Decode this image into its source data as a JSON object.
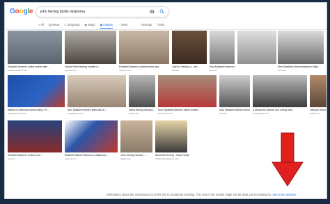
{
  "search": {
    "query": "john herring family oklahoma"
  },
  "logo": {
    "letters": [
      "G",
      "o",
      "o",
      "g",
      "l",
      "e"
    ],
    "colors": [
      "#4285F4",
      "#EA4335",
      "#FBBC05",
      "#4285F4",
      "#34A853",
      "#EA4335"
    ]
  },
  "tabs": [
    {
      "label": "All",
      "icon": "search-icon"
    },
    {
      "label": "News",
      "icon": "news-icon"
    },
    {
      "label": "Shopping",
      "icon": "tag-icon"
    },
    {
      "label": "Maps",
      "icon": "map-pin-icon"
    },
    {
      "label": "Images",
      "icon": "image-icon",
      "active": true
    },
    {
      "label": "More",
      "icon": "more-icon"
    }
  ],
  "tools": {
    "settings": "Settings",
    "tools": "Tools"
  },
  "results": [
    {
      "caption": "Elizabeth Warren's oldest brother dies ...",
      "source": "foxnewsnetwork.com"
    },
    {
      "caption": "Donald Reed Herring, brother of ...",
      "source": "nytimes.com"
    },
    {
      "caption": "Elizabeth Warren's oldest brother dies...",
      "source": "nytimes.com"
    },
    {
      "caption": "John M. Herring Jr. - the ...",
      "source": "ew.com"
    },
    {
      "caption": "How Elizabeth Warren's brothers are ...",
      "source": "wsj.com"
    },
    {
      "caption": "How Elizabeth Warren learned to Fight ...",
      "source": "time.com"
    },
    {
      "caption": "Warren's Oklahoma homecoming: 'It's ...",
      "source": "washingtonpost.com"
    },
    {
      "caption": "Sen. Elizabeth Warren takes aim at ...",
      "source": "theguardian.com"
    },
    {
      "caption": "David Herring Obituary - ...",
      "source": "legacy.com"
    },
    {
      "caption": "How Elizabeth Warren's oldest brother ...",
      "source": "oklahoman.com"
    },
    {
      "caption": "How Elizabeth Warren learned to ...",
      "source": "wsj.com"
    },
    {
      "caption": "A window for Warren and a fringe that ...",
      "source": "bostonglobe.com"
    },
    {
      "caption": "Obituary Guest...",
      "source": "legacy.com"
    },
    {
      "caption": "Elizabeth Warren's brothers are ...",
      "source": "wsj.com"
    },
    {
      "caption": "Elizabeth Warren Returns to Oklahoma ...",
      "source": "nytimes.com"
    },
    {
      "caption": "John Herring Obituary - ...",
      "source": "legacy.com"
    },
    {
      "caption": "Alexis Dill Herring - Tulsa Family ...",
      "source": "tulsafamilymagazine.com"
    }
  ],
  "notice": {
    "text": "Information about the coronavirus (COVID-19) is constantly evolving. The rest of the results might not be what you're looking for.",
    "link": "See more anyway"
  },
  "accent": "#1a73e8",
  "arrow_color": "#e01f1f"
}
